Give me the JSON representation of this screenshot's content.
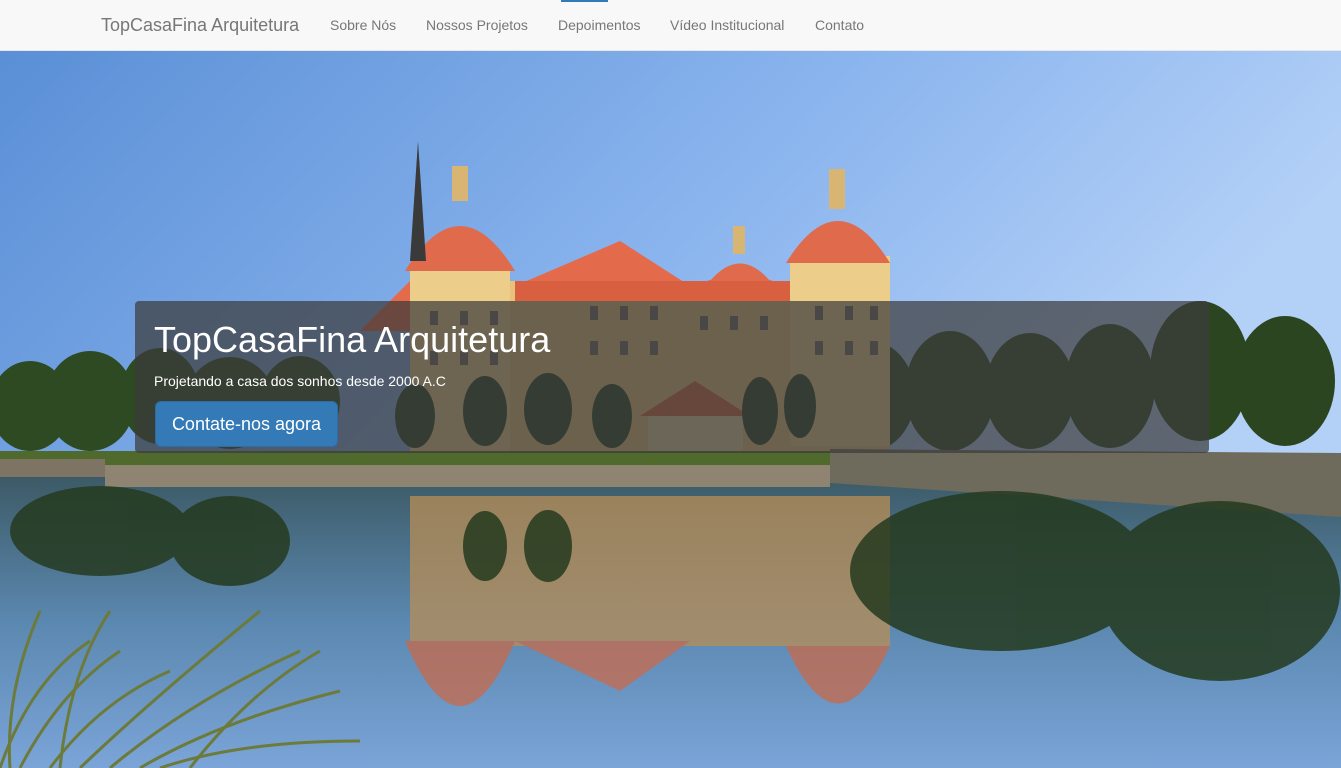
{
  "navbar": {
    "brand": "TopCasaFina Arquitetura",
    "items": [
      {
        "label": "Sobre Nós"
      },
      {
        "label": "Nossos Projetos"
      },
      {
        "label": "Depoimentos"
      },
      {
        "label": "Vídeo Institucional"
      },
      {
        "label": "Contato"
      }
    ],
    "active_accent": "#337ab7"
  },
  "hero": {
    "title": "TopCasaFina Arquitetura",
    "subtitle": "Projetando a casa dos sonhos desde 2000 A.C",
    "cta_label": "Contate-nos agora",
    "cta_color": "#337ab7",
    "image": "castle-lake-photo"
  }
}
